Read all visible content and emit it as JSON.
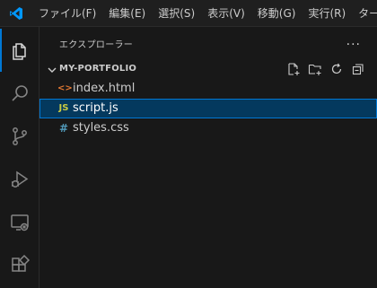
{
  "colors": {
    "accent": "#0078d4",
    "html_icon": "#e37933",
    "js_icon": "#cbcb41",
    "css_icon": "#519aba",
    "logo": "#0098ff",
    "selection_bg": "#04395e"
  },
  "titlebar": {
    "logo_icon": "vscode-logo-icon",
    "menu": [
      {
        "label": "ファイル(F)"
      },
      {
        "label": "編集(E)"
      },
      {
        "label": "選択(S)"
      },
      {
        "label": "表示(V)"
      },
      {
        "label": "移動(G)"
      },
      {
        "label": "実行(R)"
      },
      {
        "label": "ターミ"
      }
    ]
  },
  "activity_bar": {
    "items": [
      {
        "name": "explorer-icon",
        "active": true
      },
      {
        "name": "search-icon",
        "active": false
      },
      {
        "name": "source-control-icon",
        "active": false
      },
      {
        "name": "run-debug-icon",
        "active": false
      },
      {
        "name": "remote-explorer-icon",
        "active": false
      },
      {
        "name": "extensions-icon",
        "active": false
      }
    ]
  },
  "sidebar": {
    "title": "エクスプローラー",
    "more_actions": "...",
    "folder": {
      "name": "MY-PORTFOLIO",
      "actions": [
        "new-file-icon",
        "new-folder-icon",
        "refresh-icon",
        "collapse-all-icon"
      ]
    },
    "files": [
      {
        "name": "index.html",
        "icon": "<>",
        "selected": false
      },
      {
        "name": "script.js",
        "icon": "JS",
        "selected": true
      },
      {
        "name": "styles.css",
        "icon": "#",
        "selected": false
      }
    ]
  }
}
